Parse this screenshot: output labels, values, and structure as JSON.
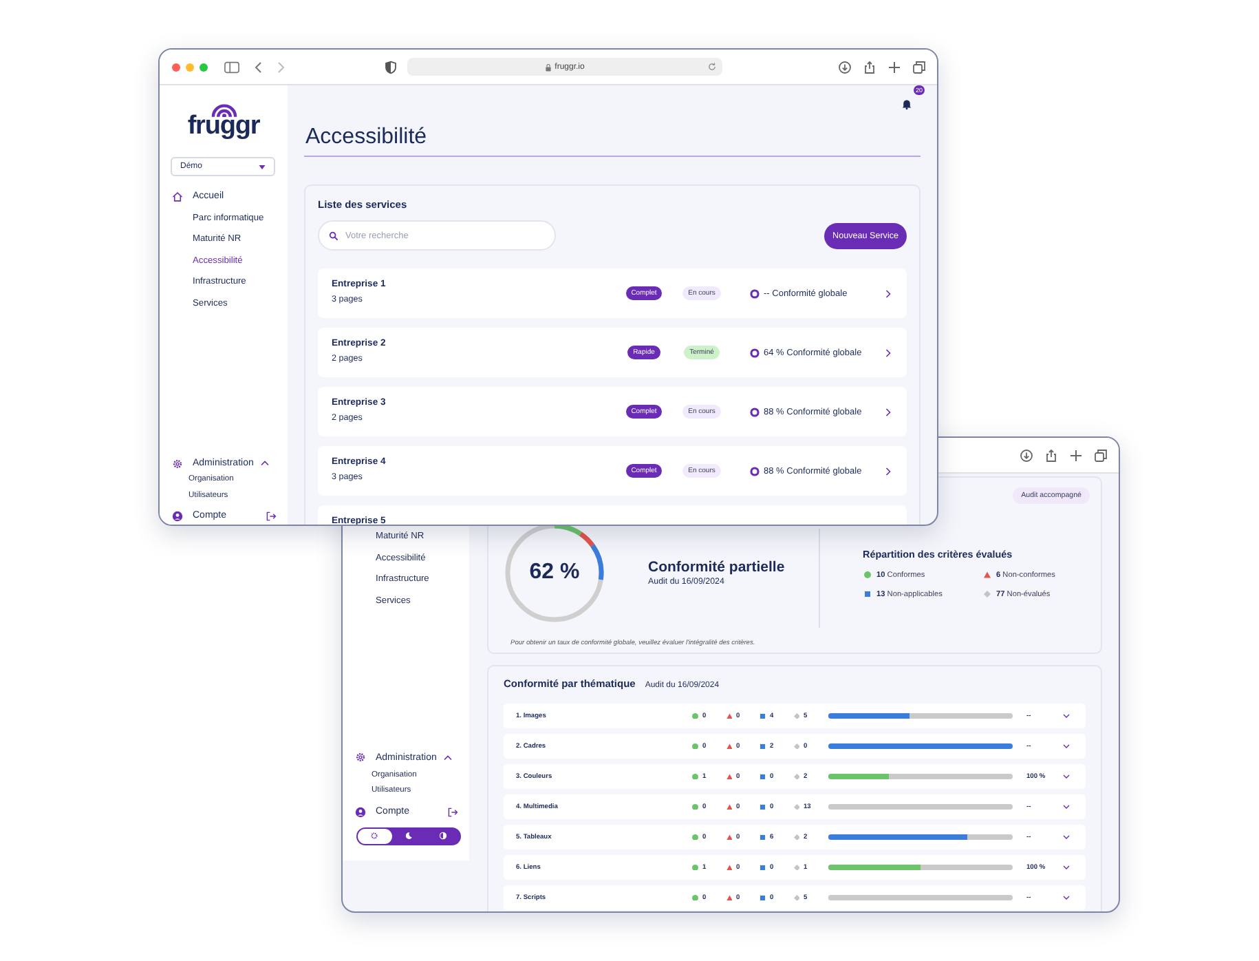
{
  "front_window": {
    "address": "fruggr.io",
    "notification_count": "20",
    "logo": "fruggr",
    "org_select": "Démo",
    "nav": [
      {
        "label": "Accueil",
        "selected": false,
        "children": [
          {
            "label": "Parc informatique",
            "selected": false
          },
          {
            "label": "Maturité NR",
            "selected": false
          },
          {
            "label": "Accessibilité",
            "selected": true
          },
          {
            "label": "Infrastructure",
            "selected": false
          },
          {
            "label": "Services",
            "selected": false
          }
        ]
      }
    ],
    "admin": {
      "label": "Administration",
      "expanded": true,
      "children": [
        "Organisation",
        "Utilisateurs"
      ]
    },
    "account": "Compte",
    "page_title": "Accessibilité",
    "services_card": {
      "title": "Liste des services",
      "search_placeholder": "Votre recherche",
      "new_button": "Nouveau Service",
      "services": [
        {
          "name": "Entreprise 1",
          "pages": "3 pages",
          "type": "Complet",
          "status": "En cours",
          "color": "#f1eafc",
          "conformity": "-- Conformité globale"
        },
        {
          "name": "Entreprise 2",
          "pages": "2 pages",
          "type": "Rapide",
          "status": "Terminé",
          "color": "#cdf1c9",
          "conformity": "64 % Conformité globale"
        },
        {
          "name": "Entreprise 3",
          "pages": "2 pages",
          "type": "Complet",
          "status": "En cours",
          "color": "#f1eafc",
          "conformity": "88 % Conformité globale"
        },
        {
          "name": "Entreprise 4",
          "pages": "3 pages",
          "type": "Complet",
          "status": "En cours",
          "color": "#f1eafc",
          "conformity": "88 % Conformité globale"
        },
        {
          "name": "Entreprise 5"
        }
      ]
    }
  },
  "back_window": {
    "nav": [
      {
        "label": "Maturité NR",
        "selected": false
      },
      {
        "label": "Accessibilité",
        "selected": false
      },
      {
        "label": "Infrastructure",
        "selected": false
      },
      {
        "label": "Services",
        "selected": false
      }
    ],
    "admin": {
      "label": "Administration",
      "expanded": true,
      "children": [
        "Organisation",
        "Utilisateurs"
      ]
    },
    "account": "Compte",
    "theme_options": [
      {
        "kind": "light",
        "selected": true
      },
      {
        "kind": "dark",
        "selected": false
      },
      {
        "kind": "contrast",
        "selected": false
      }
    ],
    "overview": {
      "badge": "Audit accompagné",
      "score": "62 %",
      "verdict": "Conformité partielle",
      "audit_date": "Audit du 16/09/2024",
      "breakdown_title": "Répartition des critères évalués",
      "breakdown": [
        {
          "kind": "conforme",
          "count": "10",
          "label": "Conformes"
        },
        {
          "kind": "non_conforme",
          "count": "6",
          "label": "Non-conformes"
        },
        {
          "kind": "non_applicable",
          "count": "13",
          "label": "Non-applicables"
        },
        {
          "kind": "non_evalue",
          "count": "77",
          "label": "Non-évalués"
        }
      ],
      "note": "Pour obtenir un taux de conformité globale, veuillez évaluer l'intégralité des critères."
    },
    "themes": {
      "title": "Conformité par thématique",
      "audit_date": "Audit du 16/09/2024",
      "rows": [
        {
          "name": "1. Images",
          "counts": [
            "0",
            "0",
            "4",
            "5"
          ],
          "level": 0.44,
          "rate": "--"
        },
        {
          "name": "2. Cadres",
          "counts": [
            "0",
            "0",
            "2",
            "0"
          ],
          "level": 1,
          "rate": "--"
        },
        {
          "name": "3. Couleurs",
          "counts": [
            "1",
            "0",
            "0",
            "2"
          ],
          "level": 0.33,
          "rate": "100 %"
        },
        {
          "name": "4. Multimedia",
          "counts": [
            "0",
            "0",
            "0",
            "13"
          ],
          "level": 0,
          "rate": "--"
        },
        {
          "name": "5. Tableaux",
          "counts": [
            "0",
            "0",
            "6",
            "2"
          ],
          "level": 0.75,
          "rate": "--"
        },
        {
          "name": "6. Liens",
          "counts": [
            "1",
            "0",
            "0",
            "1"
          ],
          "level": 0.5,
          "rate": "100 %"
        },
        {
          "name": "7. Scripts",
          "counts": [
            "0",
            "0",
            "0",
            "5"
          ],
          "level": 0,
          "rate": "--"
        }
      ]
    }
  }
}
